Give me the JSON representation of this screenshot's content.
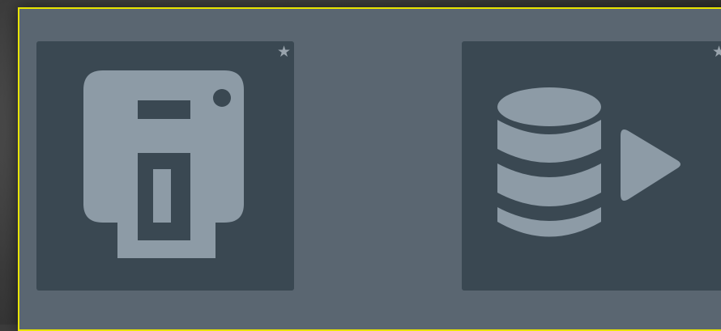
{
  "tiles": [
    {
      "icon": "save-floppy-icon",
      "favorite_glyph": "★",
      "favorite_icon": "star-icon"
    },
    {
      "icon": "database-play-icon",
      "favorite_glyph": "★",
      "favorite_icon": "star-icon"
    }
  ],
  "colors": {
    "panel_background": "#5a6671",
    "panel_border": "#e9e400",
    "tile_background": "#3a4852",
    "icon_color": "#8d9ba6",
    "star_color": "#99a4ad"
  }
}
